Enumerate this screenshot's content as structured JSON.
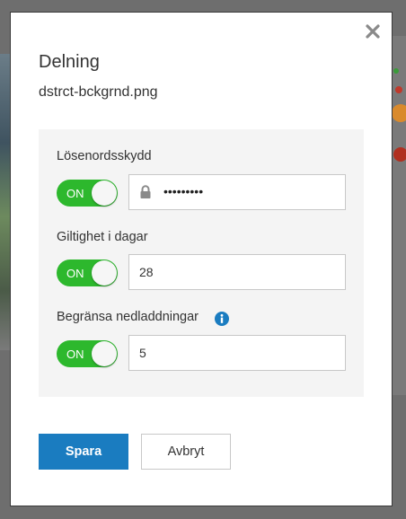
{
  "dialog": {
    "title": "Delning",
    "filename": "dstrct-bckgrnd.png",
    "close_icon": "close-icon"
  },
  "password": {
    "label": "Lösenordsskydd",
    "toggle_label": "ON",
    "toggle_on": true,
    "masked_value": "•••••••••",
    "icon": "lock-icon"
  },
  "validity": {
    "label": "Giltighet i dagar",
    "toggle_label": "ON",
    "toggle_on": true,
    "value": "28"
  },
  "downloads": {
    "label": "Begränsa nedladdningar",
    "toggle_label": "ON",
    "toggle_on": true,
    "value": "5",
    "info_icon": "info-icon"
  },
  "actions": {
    "save_label": "Spara",
    "cancel_label": "Avbryt"
  },
  "colors": {
    "toggle_on": "#2db82d",
    "primary": "#1a7cc0",
    "panel": "#f4f4f4"
  }
}
